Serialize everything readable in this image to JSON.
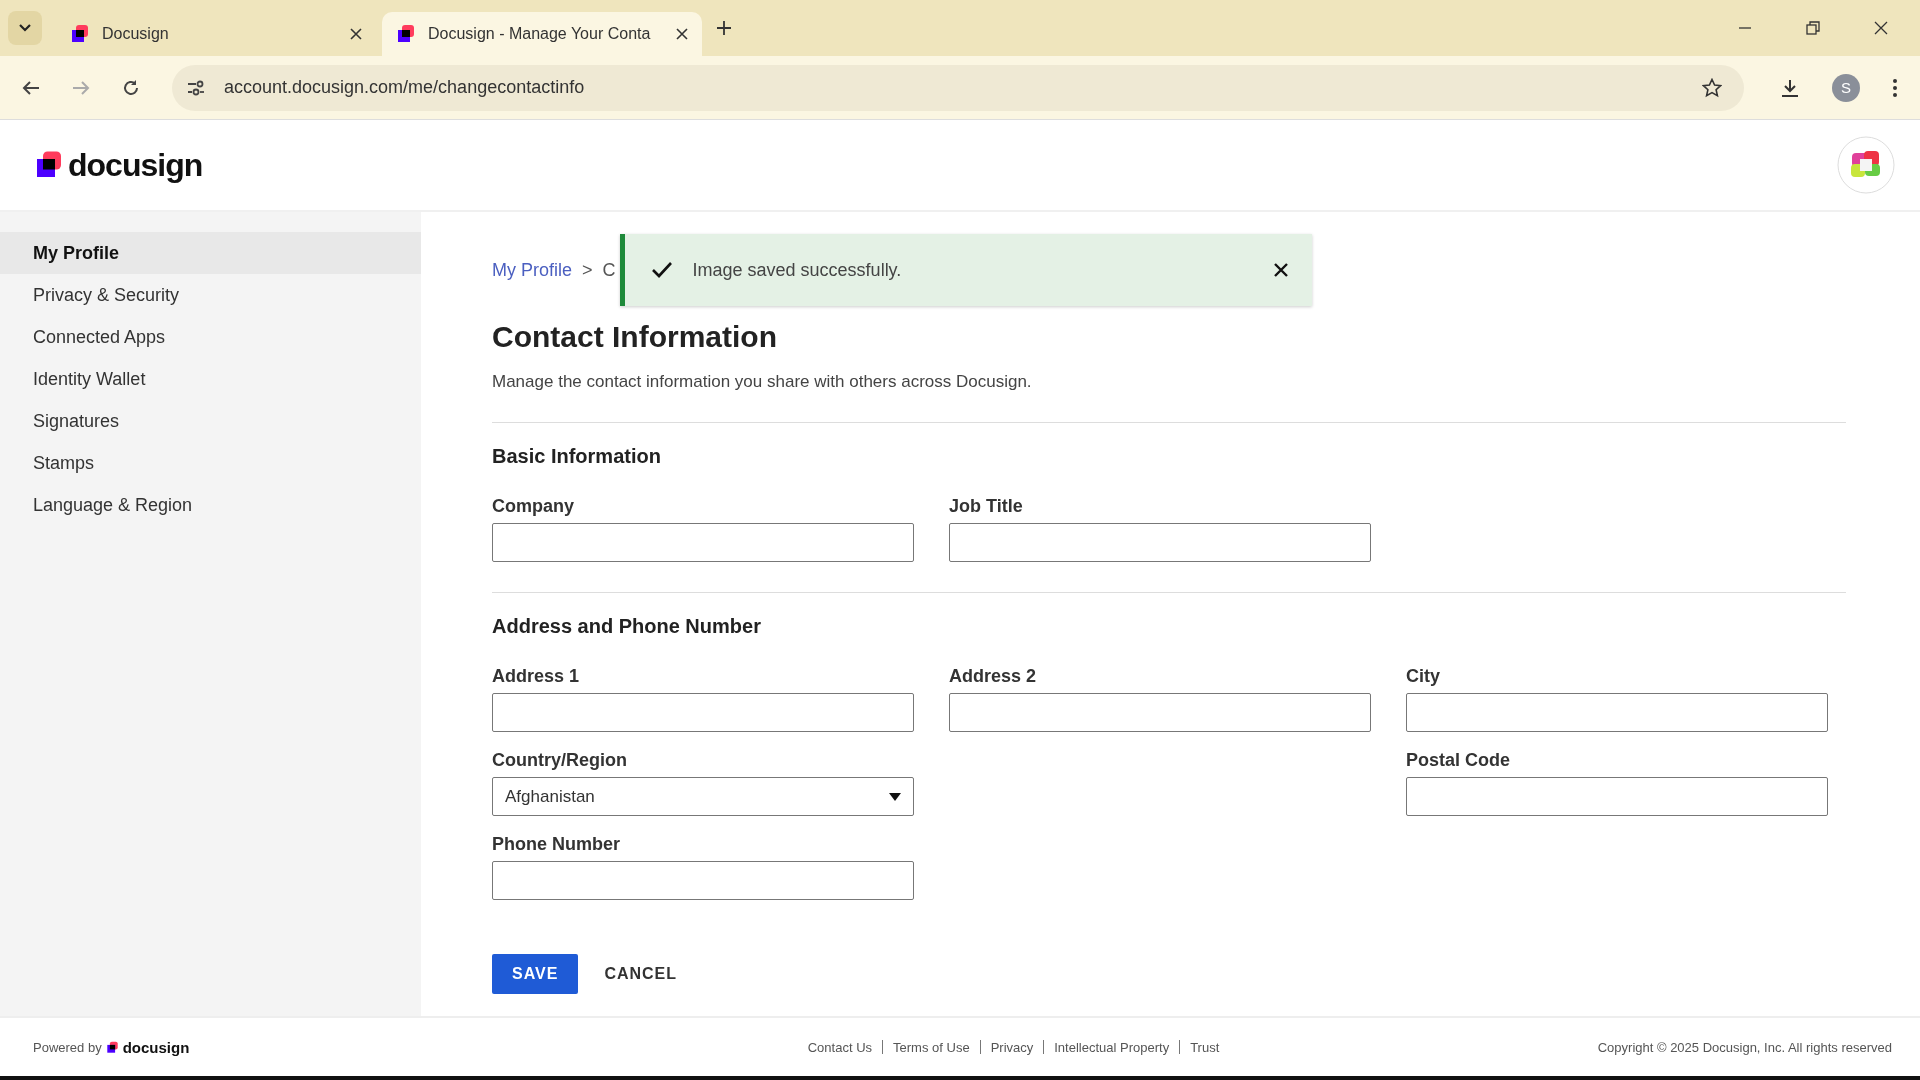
{
  "browser": {
    "tabs": [
      {
        "title": "Docusign",
        "selected": false
      },
      {
        "title": "Docusign - Manage Your Conta",
        "selected": true
      }
    ],
    "url": "account.docusign.com/me/changecontactinfo",
    "profile_initial": "S"
  },
  "header": {
    "logo": "docusign"
  },
  "sidebar": {
    "items": [
      {
        "label": "My Profile",
        "selected": true
      },
      {
        "label": "Privacy & Security",
        "selected": false
      },
      {
        "label": "Connected Apps",
        "selected": false
      },
      {
        "label": "Identity Wallet",
        "selected": false
      },
      {
        "label": "Signatures",
        "selected": false
      },
      {
        "label": "Stamps",
        "selected": false
      },
      {
        "label": "Language & Region",
        "selected": false
      }
    ]
  },
  "breadcrumb": {
    "items": [
      "My Profile",
      "C"
    ],
    "separator": ">"
  },
  "toast": {
    "message": "Image saved successfully."
  },
  "title": "Contact Information",
  "description": "Manage the contact information you share with others across Docusign.",
  "sections": [
    {
      "heading": "Basic Information",
      "rows": [
        [
          {
            "kind": "text",
            "label": "Company"
          },
          {
            "kind": "text",
            "label": "Job Title"
          }
        ]
      ]
    },
    {
      "heading": "Address and Phone Number",
      "rows": [
        [
          {
            "kind": "text",
            "label": "Address 1"
          },
          {
            "kind": "text",
            "label": "Address 2"
          },
          {
            "kind": "text",
            "label": "City"
          }
        ],
        [
          {
            "kind": "select",
            "label": "Country/Region",
            "value": "Afghanistan"
          },
          {
            "kind": "spacer"
          },
          {
            "kind": "text",
            "label": "Postal Code"
          }
        ],
        [
          {
            "kind": "text",
            "label": "Phone Number"
          }
        ]
      ]
    }
  ],
  "buttons": [
    {
      "label": "SAVE",
      "kind": "primary"
    },
    {
      "label": "CANCEL",
      "kind": "secondary"
    }
  ],
  "footer": {
    "powered_by": "Powered by",
    "logo": "docusign",
    "links": [
      "Contact Us",
      "Terms of Use",
      "Privacy",
      "Intellectual Property",
      "Trust"
    ],
    "copyright": "Copyright © 2025 Docusign, Inc. All rights reserved"
  }
}
